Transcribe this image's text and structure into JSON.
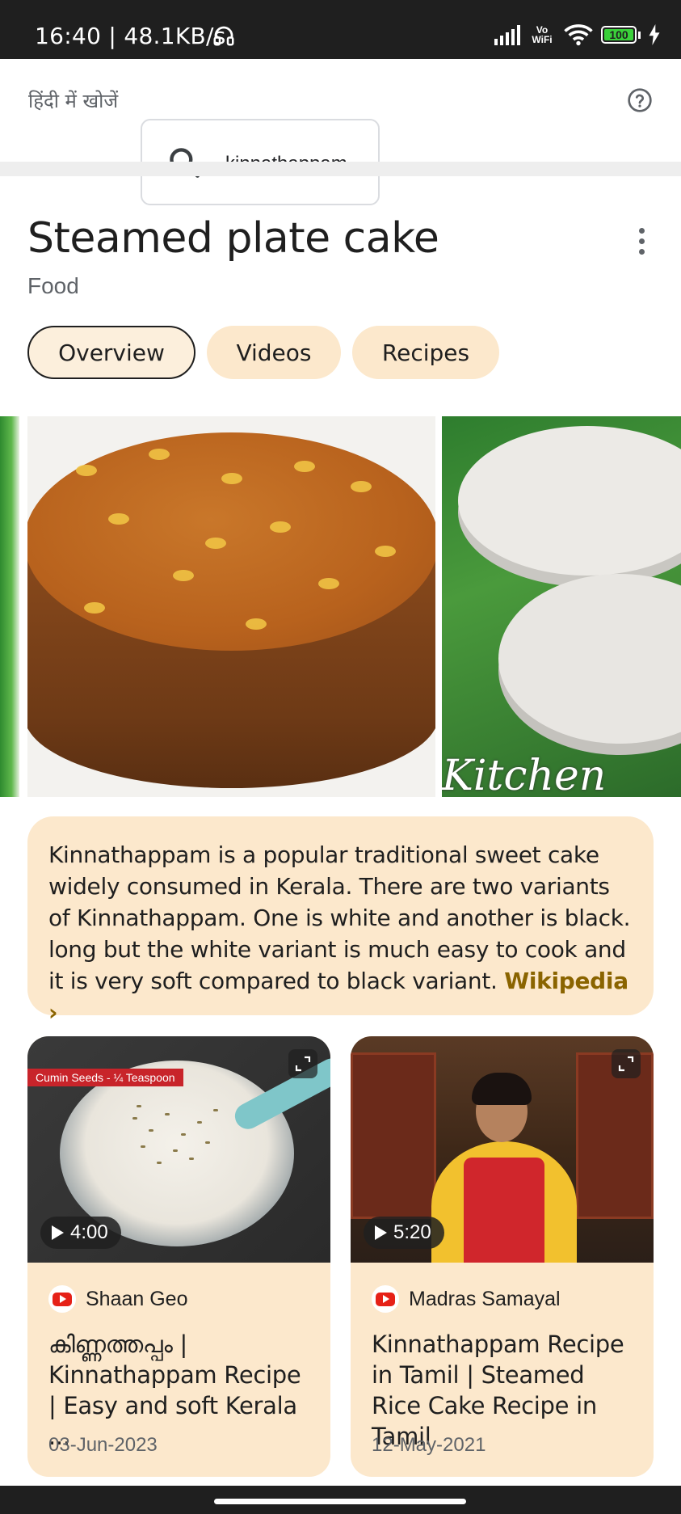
{
  "status_bar": {
    "time_speed": "16:40 | 48.1KB/s",
    "vo_wifi": "Vo\nWiFi",
    "battery": "100",
    "icons": [
      "headphones-icon",
      "signal-icon",
      "wifi-icon",
      "battery-icon",
      "charging-icon"
    ]
  },
  "search": {
    "hindi_link": "हिंदी में खोजें",
    "query": "kinnathappam",
    "help_icon": "help-circle-icon"
  },
  "entity": {
    "title": "Steamed plate cake",
    "subtitle": "Food"
  },
  "tabs": [
    {
      "label": "Overview",
      "active": true
    },
    {
      "label": "Videos",
      "active": false
    },
    {
      "label": "Recipes",
      "active": false
    }
  ],
  "images": {
    "watermark": "Kitchen"
  },
  "summary": {
    "text": "Kinnathappam is a popular traditional sweet cake widely consumed in Kerala. There are two variants of Kinnathappam. One is white and another is black. long but the white variant is much easy to cook and it is very soft compared to black variant.",
    "source_link": "Wikipedia ›"
  },
  "videos": [
    {
      "thumb_label": "Cumin Seeds - ¼ Teaspoon",
      "duration": "4:00",
      "channel": "Shaan Geo",
      "title": "കിണ്ണത്തപ്പം | Kinnathappam Recipe | Easy and soft Kerala ...",
      "date": "03-Jun-2023"
    },
    {
      "thumb_label": "",
      "duration": "5:20",
      "channel": "Madras Samayal",
      "title": "Kinnathappam Recipe in Tamil | Steamed Rice Cake Recipe in Tamil",
      "date": "12-May-2021"
    }
  ],
  "colors": {
    "chip_bg": "#fce8cc",
    "card_bg": "#fce8cc",
    "link": "#8a6400",
    "status_bar": "#1f1f1f"
  }
}
